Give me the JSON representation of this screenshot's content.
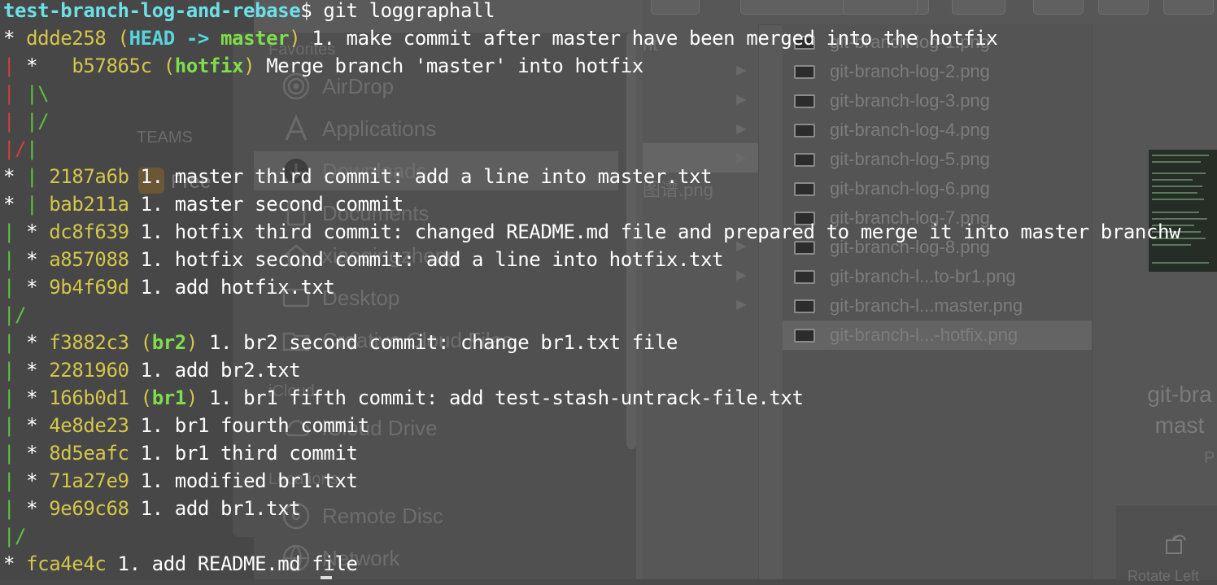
{
  "terminal": {
    "prompt_dir": "test-branch-log-and-rebase",
    "prompt_symbol": "$ ",
    "command": "git loggraphall",
    "lines": [
      {
        "graph": "* ",
        "hash": "ddde258",
        "refs_open": " (",
        "head": "HEAD -> ",
        "branch": "master",
        "refs_close": ")",
        "msg": " 1. make commit after master have been merged into the hotfix"
      },
      {
        "graph_red": "| ",
        "graph": "*   ",
        "hash": "b57865c",
        "refs_open": " (",
        "head": "",
        "branch": "hotfix",
        "refs_close": ")",
        "msg": " Merge branch 'master' into hotfix"
      },
      {
        "graph_red": "| ",
        "graph_green": "|\\"
      },
      {
        "graph_red": "| ",
        "graph_green": "|/"
      },
      {
        "graph_red": "|/",
        "graph_green": "|"
      },
      {
        "graph": "* ",
        "graph_green": "| ",
        "hash": "2187a6b",
        "msg": " 1. master third commit: add a line into master.txt"
      },
      {
        "graph": "* ",
        "graph_green": "| ",
        "hash": "bab211a",
        "msg": " 1. master second commit"
      },
      {
        "graph_green": "| ",
        "graph": "* ",
        "hash": "dc8f639",
        "msg": " 1. hotfix third commit: changed README.md file and prepared to merge it into master branchw"
      },
      {
        "graph_green": "| ",
        "graph": "* ",
        "hash": "a857088",
        "msg": " 1. hotfix second commit: add a line into hotfix.txt"
      },
      {
        "graph_green": "| ",
        "graph": "* ",
        "hash": "9b4f69d",
        "msg": " 1. add hotfix.txt"
      },
      {
        "graph_green": "|/"
      },
      {
        "graph_green": "| ",
        "graph": "* ",
        "hash": "f3882c3",
        "refs_open": " (",
        "head": "",
        "branch": "br2",
        "refs_close": ")",
        "msg": " 1. br2 second commit: change br1.txt file"
      },
      {
        "graph_green": "| ",
        "graph": "* ",
        "hash": "2281960",
        "msg": " 1. add br2.txt"
      },
      {
        "graph_green": "| ",
        "graph": "* ",
        "hash": "166b0d1",
        "refs_open": " (",
        "head": "",
        "branch": "br1",
        "refs_close": ")",
        "msg": " 1. br1 fifth commit: add test-stash-untrack-file.txt"
      },
      {
        "graph_green": "| ",
        "graph": "* ",
        "hash": "4e8de23",
        "msg": " 1. br1 fourth commit"
      },
      {
        "graph_green": "| ",
        "graph": "* ",
        "hash": "8d5eafc",
        "msg": " 1. br1 third commit"
      },
      {
        "graph_green": "| ",
        "graph": "* ",
        "hash": "71a27e9",
        "msg": " 1. modified br1.txt"
      },
      {
        "graph_green": "| ",
        "graph": "* ",
        "hash": "9e69c68",
        "msg": " 1. add br1.txt"
      },
      {
        "graph_green": "|/"
      },
      {
        "graph": "* ",
        "hash": "fca4e4c",
        "msg": " 1. add README.md file"
      }
    ]
  },
  "finder": {
    "sidebar": {
      "favorites_heading": "Favorites",
      "teams_heading": "TEAMS",
      "icloud_heading": "iCloud",
      "locations_heading": "Locations",
      "items": {
        "airdrop": "AirDrop",
        "applications": "Applications",
        "downloads": "Downloads",
        "documents": "Documents",
        "user": "xiaoqingzheng",
        "desktop": "Desktop",
        "creative_cloud": "Creative Cloud Files",
        "icloud_drive": "iCloud Drive",
        "remote_disc": "Remote Disc",
        "network": "Network"
      },
      "teams_item": "Free"
    },
    "column2": {
      "partial_item": "图谱.png",
      "partial_top": "nt"
    },
    "files": [
      "git-branch-log-1.png",
      "git-branch-log-2.png",
      "git-branch-log-3.png",
      "git-branch-log-4.png",
      "git-branch-log-5.png",
      "git-branch-log-6.png",
      "git-branch-log-7.png",
      "git-branch-log-8.png",
      "git-branch-l...to-br1.png",
      "git-branch-l...master.png",
      "git-branch-l...-hotfix.png"
    ],
    "selected_file_index": 10,
    "preview": {
      "name_line1": "git-bra",
      "name_line2": "mast",
      "kind": "P",
      "rotate_label": "Rotate Left"
    }
  },
  "colors": {
    "hash": "#d4c64a",
    "head": "#59d4dc",
    "branch": "#7ede4a",
    "graph_red": "#d04040",
    "graph_green": "#60c040"
  }
}
